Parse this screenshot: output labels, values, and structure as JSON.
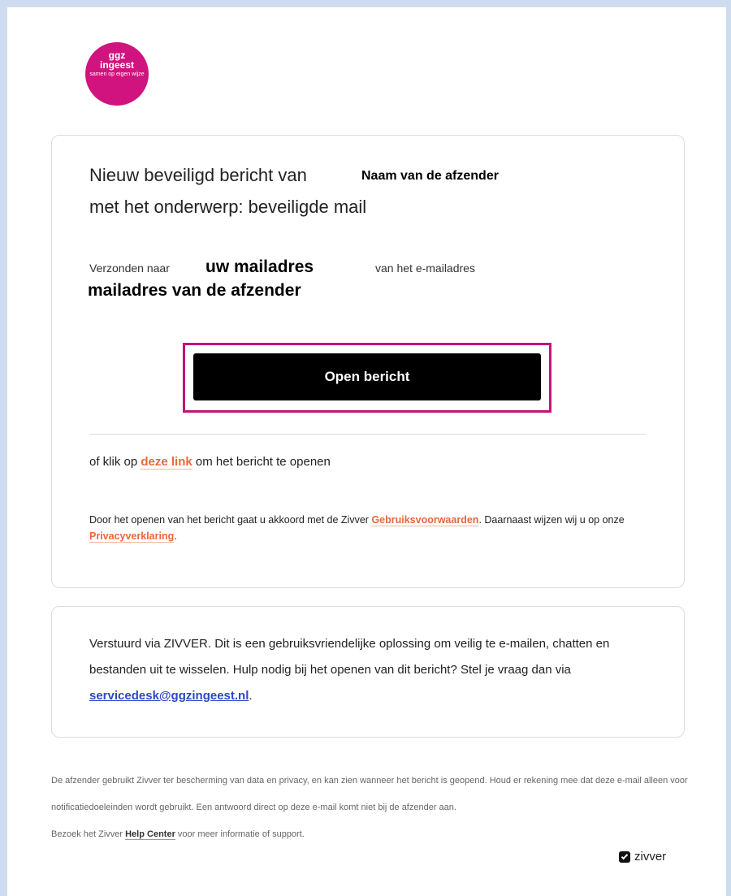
{
  "logo": {
    "line1": "ggz",
    "line2": "ingeest",
    "tagline": "samen op eigen wijze"
  },
  "message": {
    "title_prefix": "Nieuw beveiligd bericht van",
    "sender_name": "Naam van de afzender",
    "title_subject": "met het onderwerp: beveiligde mail",
    "sent_to_label": "Verzonden naar",
    "recipient": "uw mailadres",
    "from_label": "van het e-mailadres",
    "sender_address": "mailadres van de afzender"
  },
  "open_button": {
    "label": "Open bericht"
  },
  "alt_link": {
    "prefix": "of klik op",
    "link": "deze link",
    "suffix": "om het bericht te openen"
  },
  "terms": {
    "part1": "Door het openen van het bericht gaat u akkoord met de Zivver",
    "terms_link": "Gebruiksvoorwaarden",
    "part2": ". Daarnaast wijzen wij u op onze",
    "privacy_link": "Privacyverklaring",
    "part3": "."
  },
  "zivver_info": {
    "text": "Verstuurd via ZIVVER. Dit is een gebruiksvriendelijke oplossing om veilig te e-mailen, chatten en bestanden uit te wisselen. Hulp nodig bij het openen van dit bericht? Stel je vraag dan via",
    "email": "servicedesk@ggzingeest.nl",
    "end": "."
  },
  "footer": {
    "disclaimer": "De afzender gebruikt Zivver ter bescherming van data en privacy, en kan zien wanneer het bericht is geopend. Houd er rekening mee dat deze e-mail alleen voor notificatiedoeleinden wordt gebruikt. Een antwoord direct op deze e-mail komt niet bij de afzender aan.",
    "help_prefix": "Bezoek het Zivver",
    "help_link": "Help Center",
    "help_suffix": "voor meer informatie of support.",
    "brand": "zivver"
  },
  "colors": {
    "brand_magenta": "#d0137f",
    "link_orange": "#e8683a",
    "link_blue": "#2e46c8",
    "button_black": "#000000"
  }
}
